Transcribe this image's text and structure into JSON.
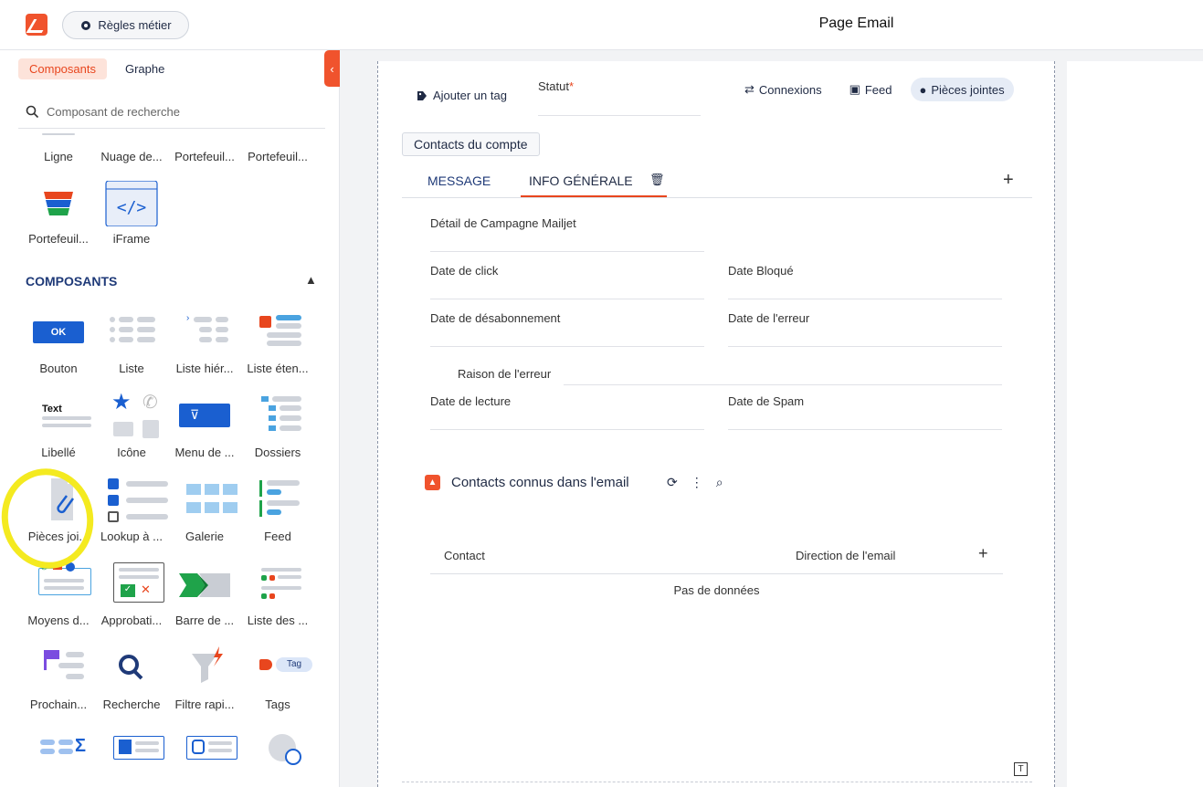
{
  "header": {
    "rules_button": "Règles métier",
    "page_title": "Page Email"
  },
  "left": {
    "tabs": [
      "Composants",
      "Graphe"
    ],
    "search_placeholder": "Composant de recherche",
    "top_items": [
      "Ligne",
      "Nuage de...",
      "Portefeuil...",
      "Portefeuil...",
      "Portefeuil...",
      "iFrame"
    ],
    "section_title": "COMPOSANTS",
    "items": [
      "Bouton",
      "Liste",
      "Liste hiér...",
      "Liste éten...",
      "Libellé",
      "Icône",
      "Menu de ...",
      "Dossiers",
      "Pièces joi...",
      "Lookup à ...",
      "Galerie",
      "Feed",
      "Moyens d...",
      "Approbati...",
      "Barre de ...",
      "Liste des ...",
      "Prochain...",
      "Recherche",
      "Filtre rapi...",
      "Tags"
    ],
    "ok_text": "OK",
    "text_icon_text": "Text",
    "tag_icon_text": "Tag"
  },
  "canvas": {
    "add_tag": "Ajouter un tag",
    "statut_label": "Statut",
    "statut_required": "*",
    "right_tabs": [
      "Connexions",
      "Feed",
      "Pièces jointes"
    ],
    "contacts_chip": "Contacts du compte",
    "message_tabs": [
      "MESSAGE",
      "INFO GÉNÉRALE"
    ],
    "fields": {
      "campagne": "Détail de Campagne Mailjet",
      "click": "Date de click",
      "bloque": "Date Bloqué",
      "desabo": "Date de désabonnement",
      "erreur_date": "Date de l'erreur",
      "raison": "Raison de l'erreur",
      "lecture": "Date de lecture",
      "spam": "Date de Spam"
    },
    "subtable": {
      "title": "Contacts connus dans l'email",
      "col_contact": "Contact",
      "col_direction": "Direction de l'email",
      "no_data": "Pas de données"
    },
    "t_icon": "T"
  },
  "colors": {
    "accent": "#f0532d",
    "navy": "#1f3a78",
    "highlight": "#f4ea20"
  }
}
